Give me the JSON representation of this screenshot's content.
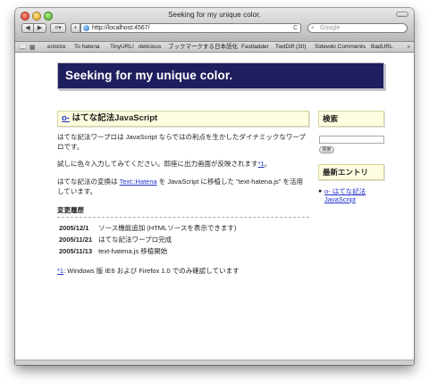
{
  "window": {
    "title": "Seeking for my unique color."
  },
  "toolbar": {
    "back": "◀",
    "forward": "▶",
    "page_menu": "⌗▾",
    "add": "+",
    "url": "http://localhost:4567/",
    "reload": "C",
    "search_placeholder": "Google"
  },
  "bookmarks": {
    "items": [
      "ectoize",
      "To hatena",
      "TinyURL!",
      "delicious",
      "ブックマークする",
      "日本語化",
      "Fastladder",
      "TwitDiff (30)",
      "Sidewiki Comments",
      "BadURL"
    ],
    "more": "»"
  },
  "page": {
    "header_title": "Seeking for my unique color.",
    "entry": {
      "link": "o-",
      "title": "はてな記法JavaScript",
      "p1": "はてな記法ワープロは JavaScript ならではの利点を生かしたダイナミックなワープロです。",
      "p2_text": "試しに色々入力してみてください。即座に出力画面が反映されます",
      "p2_note": "*1",
      "p2_end": "。",
      "p3_pre": "はてな記法の変換は ",
      "p3_link": "Text::Hatena",
      "p3_post": " を JavaScript に移植した \"text-hatena.js\" を活用しています。"
    },
    "history": {
      "heading": "変更履歴",
      "rows": [
        {
          "date": "2005/12/1",
          "text": "ソース機能追加 (HTMLソースを表示できます)"
        },
        {
          "date": "2005/11/21",
          "text": "はてな記法ワープロ完成"
        },
        {
          "date": "2005/11/13",
          "text": "text-hatena.js 移植開始"
        }
      ]
    },
    "footnote": {
      "mark": "*1",
      "text": ": Windows 版 IE6 および Firefox 1.0 でのみ確認しています"
    },
    "sidebar": {
      "search_heading": "検索",
      "search_button": "検索",
      "recent_heading": "最新エントリ",
      "recent_items": [
        "o- はてな記法JavaScript"
      ]
    }
  }
}
